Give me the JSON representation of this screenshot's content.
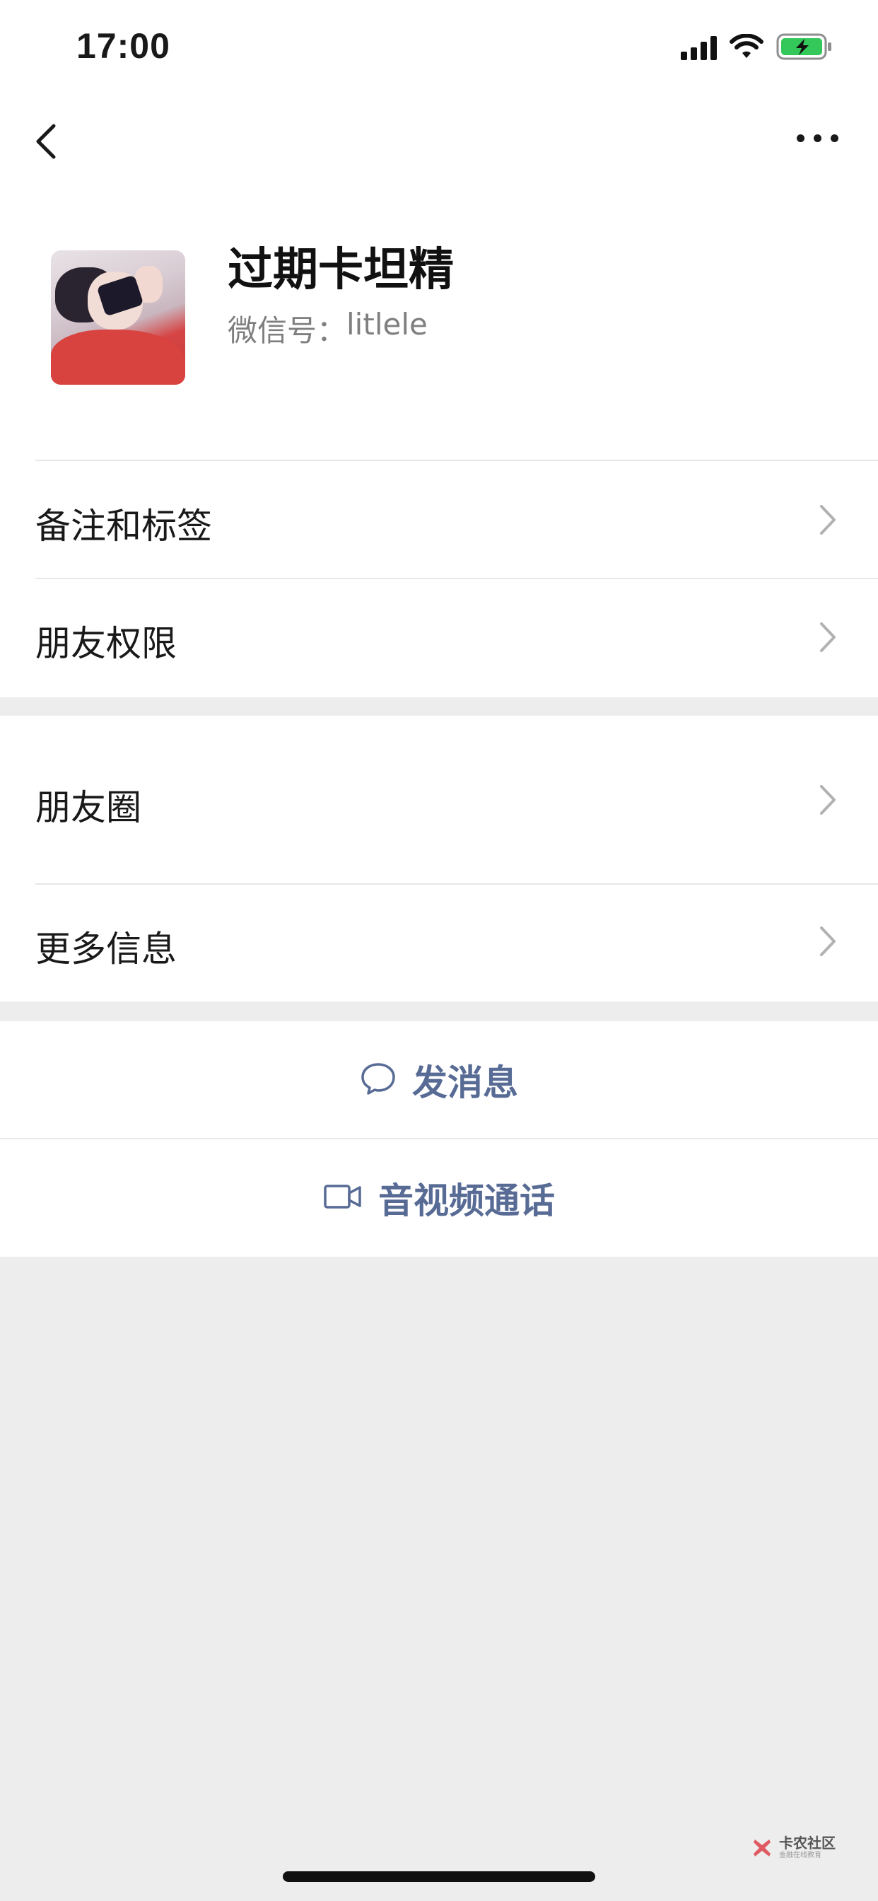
{
  "status_bar": {
    "time": "17:00"
  },
  "profile": {
    "name": "过期卡坦精",
    "wechat_id_label": "微信号：",
    "wechat_id": "litlele"
  },
  "menu_group_1": [
    {
      "label": "备注和标签"
    },
    {
      "label": "朋友权限"
    }
  ],
  "menu_group_2": [
    {
      "label": "朋友圈"
    },
    {
      "label": "更多信息"
    }
  ],
  "actions": {
    "send_message": {
      "label": "发消息",
      "icon": "chat-bubble-icon"
    },
    "video_call": {
      "label": "音视频通话",
      "icon": "video-camera-icon"
    }
  },
  "watermark": {
    "title": "卡农社区",
    "subtitle": "金融在线教育"
  },
  "colors": {
    "background": "#ededed",
    "card": "#ffffff",
    "link_blue": "#576b95",
    "secondary_text": "#7f7f7f",
    "chevron": "#b2b2b2",
    "battery_green": "#34c759"
  }
}
